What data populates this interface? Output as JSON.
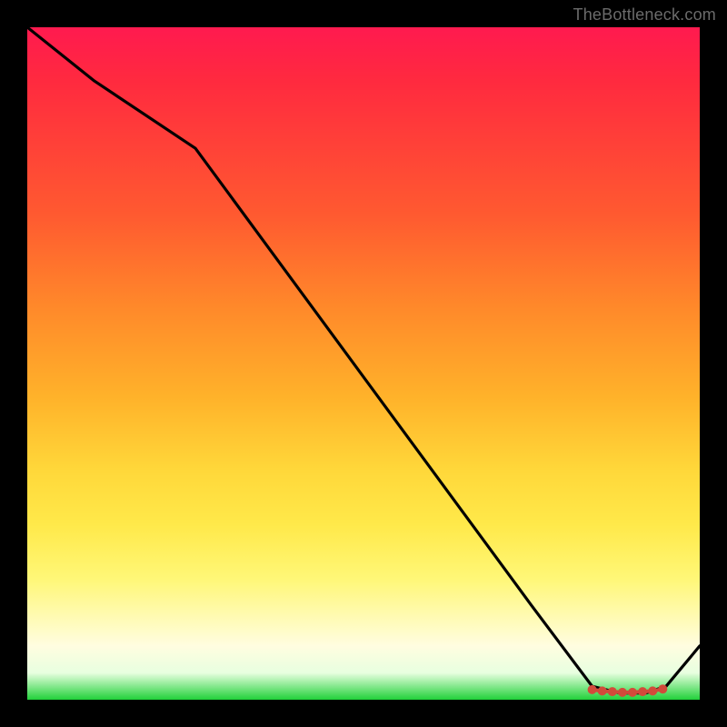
{
  "watermark": "TheBottleneck.com",
  "chart_data": {
    "type": "line",
    "title": "",
    "xlabel": "",
    "ylabel": "",
    "xlim": [
      0,
      100
    ],
    "ylim": [
      0,
      100
    ],
    "series": [
      {
        "name": "curve",
        "x": [
          0,
          10,
          25,
          50,
          75,
          84,
          88,
          92,
          95,
          100
        ],
        "y": [
          100,
          92,
          82,
          48,
          14,
          2,
          1,
          1,
          2,
          8
        ]
      }
    ],
    "markers": {
      "name": "highlight-band",
      "x": [
        84,
        85.5,
        87,
        88.5,
        90,
        91.5,
        93,
        94.5
      ],
      "y": [
        1.5,
        1.3,
        1.2,
        1.1,
        1.1,
        1.2,
        1.3,
        1.6
      ],
      "color": "#d24a3a"
    },
    "background_gradient": {
      "top": "#ff1a4f",
      "bottom": "#21d13a",
      "stops": [
        "red",
        "orange",
        "yellow",
        "pale",
        "green"
      ]
    }
  }
}
